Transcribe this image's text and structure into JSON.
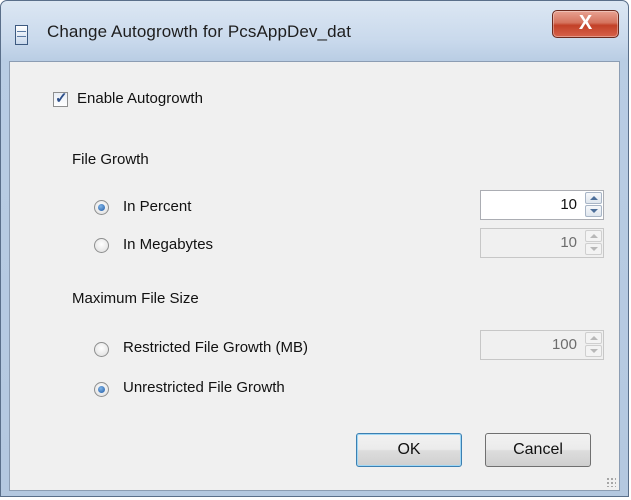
{
  "window": {
    "title": "Change Autogrowth for PcsAppDev_dat",
    "close_label": "X"
  },
  "enable_autogrowth": {
    "label": "Enable Autogrowth",
    "checked": true
  },
  "file_growth": {
    "heading": "File Growth",
    "options": [
      {
        "label": "In Percent",
        "selected": true,
        "value": "10",
        "enabled": true
      },
      {
        "label": "In Megabytes",
        "selected": false,
        "value": "10",
        "enabled": false
      }
    ]
  },
  "max_file_size": {
    "heading": "Maximum File Size",
    "options": [
      {
        "label": "Restricted File Growth (MB)",
        "selected": false,
        "value": "100",
        "enabled": false
      },
      {
        "label": "Unrestricted File Growth",
        "selected": true
      }
    ]
  },
  "buttons": {
    "ok": "OK",
    "cancel": "Cancel"
  },
  "colors": {
    "title_gradient": "#c9d9ec",
    "close_red": "#c24128",
    "client_bg": "#f0f0f0",
    "default_border": "#3c7fb1"
  }
}
